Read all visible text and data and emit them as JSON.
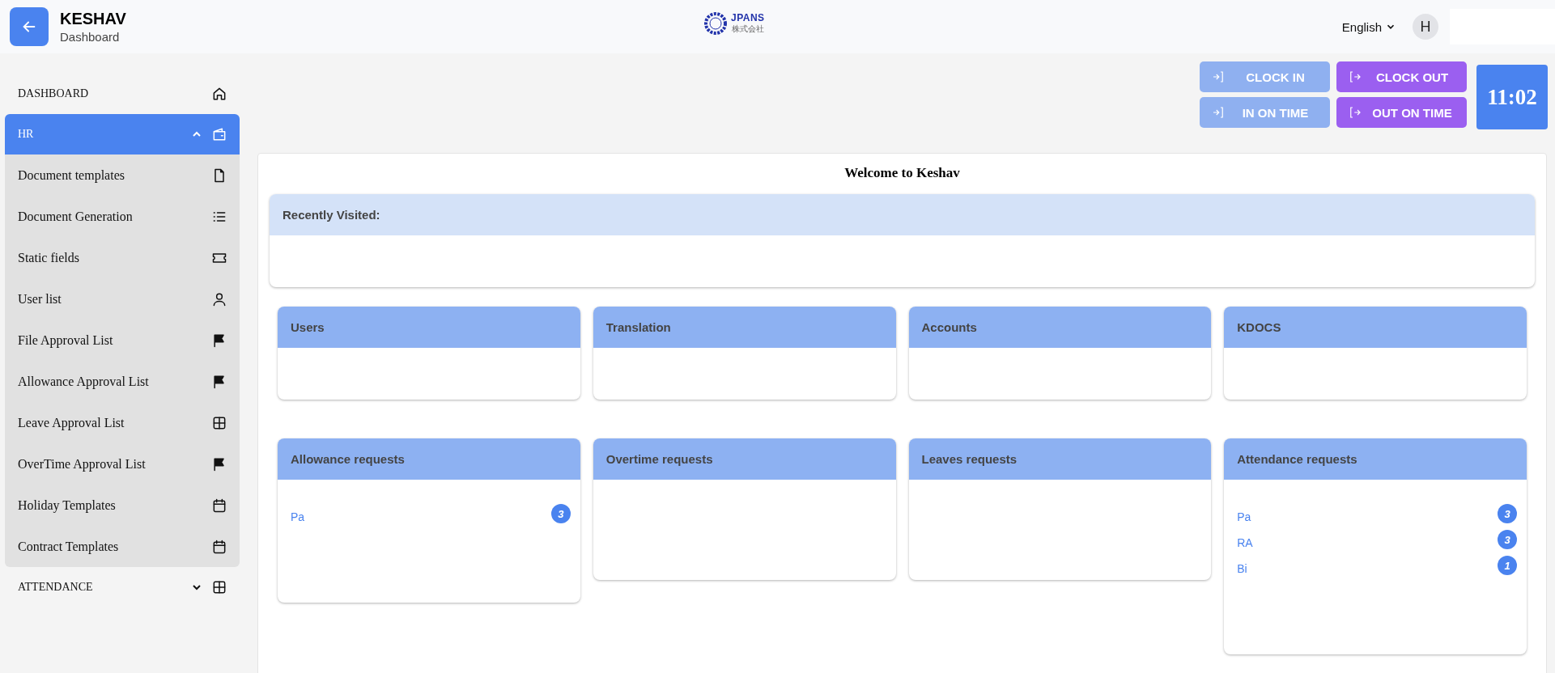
{
  "header": {
    "title": "KESHAV",
    "subtitle": "Dashboard",
    "logo": {
      "name": "JPANS",
      "subname": "株式会社"
    },
    "language": "English",
    "avatar": "H"
  },
  "sidebar": {
    "items": [
      {
        "label": "DASHBOARD",
        "selected": false
      },
      {
        "label": "HR",
        "selected": true,
        "expanded": true,
        "children": [
          {
            "label": "Document templates",
            "selected": false
          },
          {
            "label": "Document Generation",
            "selected": false
          },
          {
            "label": "Static fields",
            "selected": false
          },
          {
            "label": "User list",
            "selected": false
          },
          {
            "label": "File Approval List",
            "selected": false
          },
          {
            "label": "Allowance Approval List",
            "selected": false
          },
          {
            "label": "Leave Approval List",
            "selected": false
          },
          {
            "label": "OverTime Approval List",
            "selected": false
          },
          {
            "label": "Holiday Templates",
            "selected": false
          },
          {
            "label": "Contract Templates",
            "selected": false
          }
        ]
      },
      {
        "label": "ATTENDANCE",
        "selected": false,
        "expanded": false
      }
    ]
  },
  "clock_buttons": [
    {
      "label": "CLOCK IN",
      "kind": "in",
      "disabled": true
    },
    {
      "label": "CLOCK OUT",
      "kind": "out",
      "disabled": false
    },
    {
      "label": "IN ON TIME",
      "kind": "in",
      "disabled": true
    },
    {
      "label": "OUT ON TIME",
      "kind": "out",
      "disabled": false
    }
  ],
  "clock": "11:02",
  "welcome": "Welcome to Keshav",
  "recently_visited": {
    "title": "Recently Visited:"
  },
  "modules": [
    {
      "title": "Users"
    },
    {
      "title": "Translation"
    },
    {
      "title": "Accounts"
    },
    {
      "title": "KDOCS"
    }
  ],
  "requests": [
    {
      "title": "Allowance requests",
      "entries": [
        {
          "name": "Pa",
          "count": "3"
        }
      ]
    },
    {
      "title": "Overtime requests"
    },
    {
      "title": "Leaves requests"
    },
    {
      "title": "Attendance requests",
      "entries": [
        {
          "name": "Pa",
          "count": "3"
        },
        {
          "name": "RA",
          "count": "3"
        },
        {
          "name": "Bi",
          "count": "1"
        }
      ]
    }
  ]
}
